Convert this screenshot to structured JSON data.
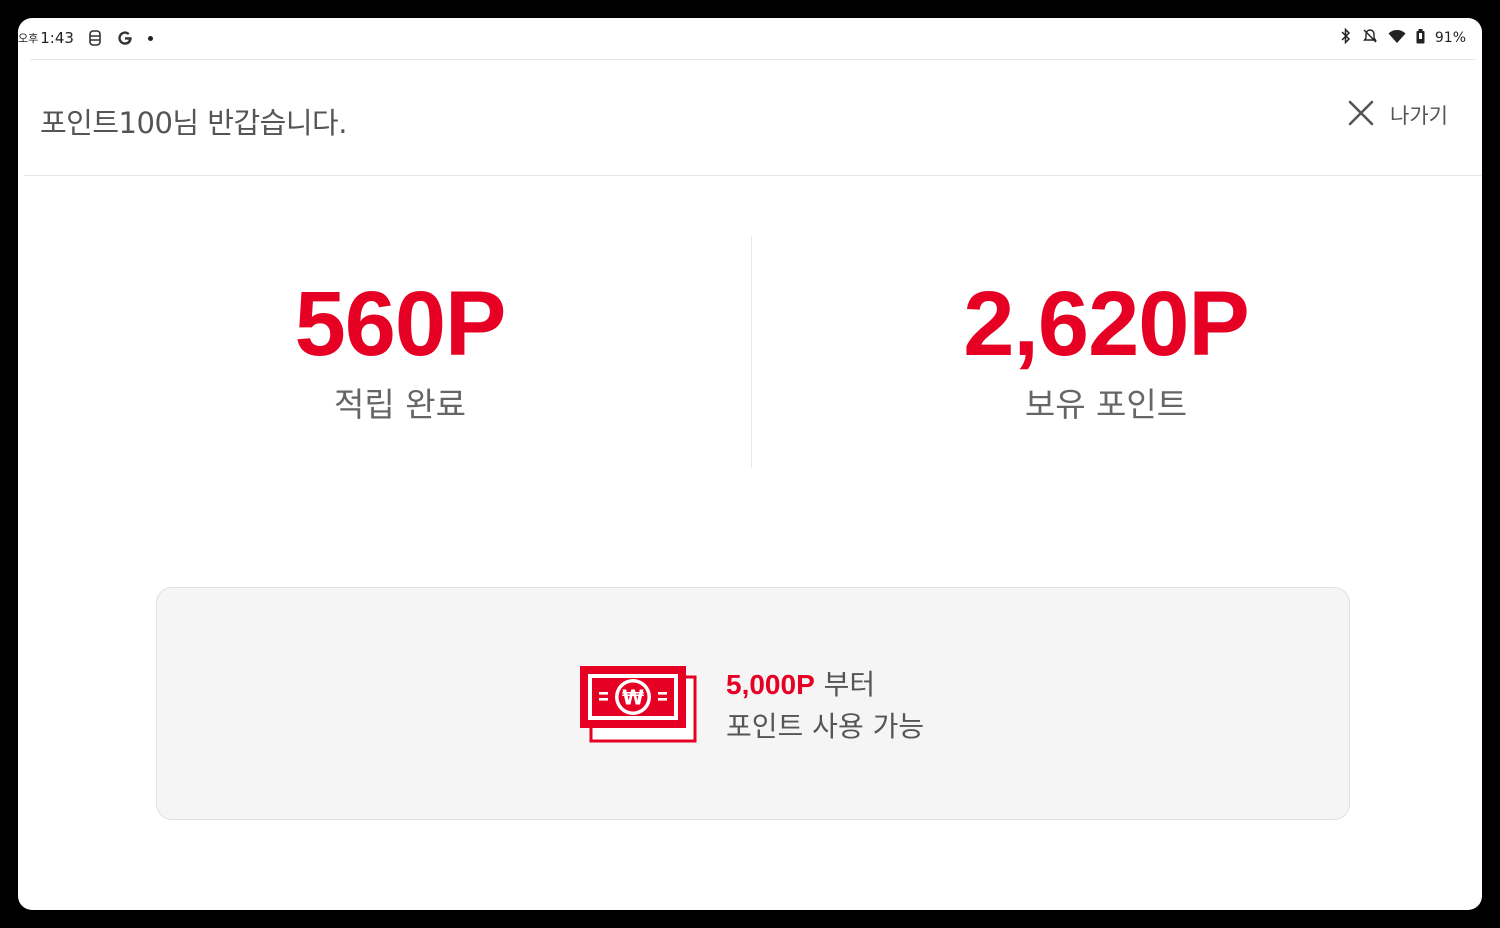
{
  "status_bar": {
    "ampm": "오후",
    "time": "1:43",
    "battery": "91%"
  },
  "header": {
    "welcome": "포인트100님 반갑습니다.",
    "exit_label": "나가기"
  },
  "points": {
    "earned_value": "560P",
    "earned_label": "적립 완료",
    "balance_value": "2,620P",
    "balance_label": "보유 포인트"
  },
  "info": {
    "threshold": "5,000P",
    "threshold_suffix": " 부터",
    "usage": "포인트 사용 가능",
    "currency_symbol": "₩"
  },
  "colors": {
    "accent": "#e60023",
    "text": "#555555",
    "box_bg": "#f5f5f5"
  },
  "icons": [
    "close-icon",
    "money-bill-icon",
    "bluetooth-icon",
    "mute-icon",
    "wifi-icon",
    "battery-icon",
    "google-icon"
  ]
}
